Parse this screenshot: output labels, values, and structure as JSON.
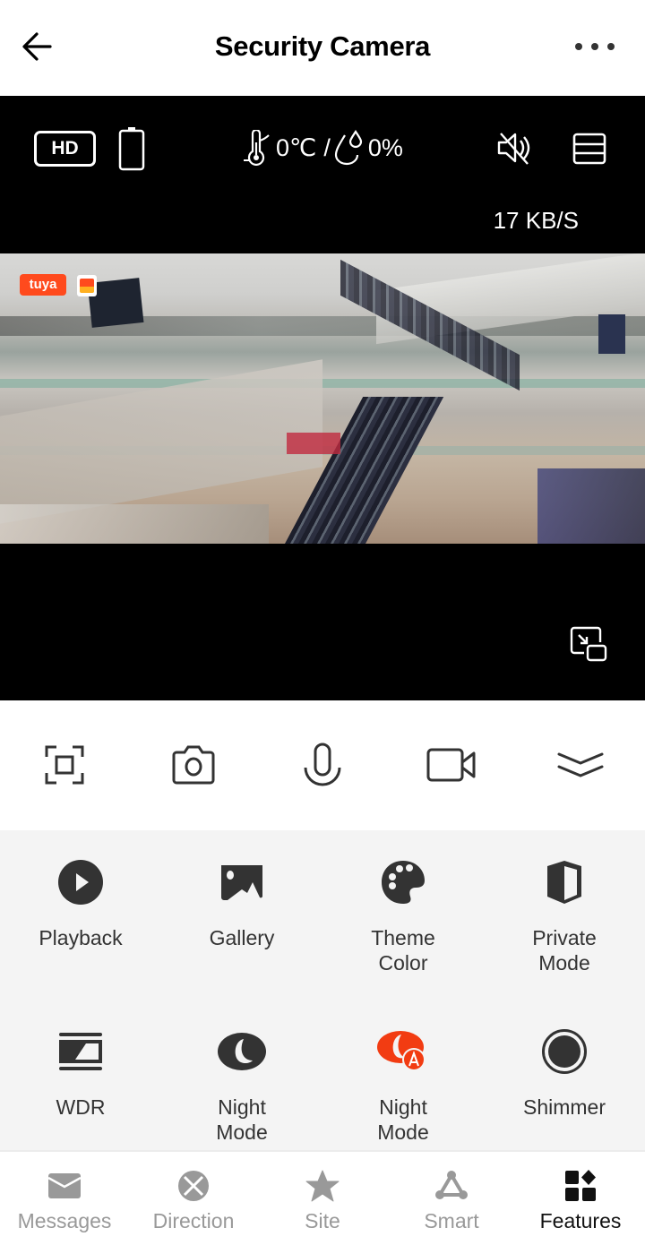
{
  "header": {
    "title": "Security Camera",
    "back_icon": "arrow-left-icon",
    "more_icon": "more-horizontal-icon"
  },
  "video": {
    "quality_badge": "HD",
    "battery_icon": "battery-icon",
    "temperature": "0℃",
    "separator": "/",
    "humidity": "0%",
    "temperature_icon": "thermometer-icon",
    "humidity_icon": "droplet-icon",
    "mute_icon": "speaker-muted-icon",
    "layout_icon": "layout-icon",
    "bitrate": "17 KB/S",
    "watermark": "tuya",
    "pip_icon": "picture-in-picture-icon"
  },
  "toolbar": {
    "items": [
      {
        "name": "fullscreen-button",
        "icon": "screen-frame-icon"
      },
      {
        "name": "screenshot-button",
        "icon": "camera-icon"
      },
      {
        "name": "talk-button",
        "icon": "microphone-icon"
      },
      {
        "name": "record-button",
        "icon": "video-camera-icon"
      },
      {
        "name": "collapse-button",
        "icon": "double-chevron-down-icon"
      }
    ]
  },
  "features": {
    "items": [
      {
        "label": "Playback",
        "icon": "play-circle-icon"
      },
      {
        "label": "Gallery",
        "icon": "image-icon"
      },
      {
        "label": "Theme\nColor",
        "icon": "palette-icon"
      },
      {
        "label": "Private\nMode",
        "icon": "shield-half-icon"
      },
      {
        "label": "WDR",
        "icon": "wdr-icon"
      },
      {
        "label": "Night\nMode",
        "icon": "moon-icon"
      },
      {
        "label": "Night\nMode",
        "icon": "moon-auto-icon",
        "active": true,
        "color": "#f23c12"
      },
      {
        "label": "Shimmer",
        "icon": "record-circle-icon"
      }
    ]
  },
  "bottom_nav": {
    "items": [
      {
        "label": "Messages",
        "icon": "envelope-icon"
      },
      {
        "label": "Direction",
        "icon": "direction-pad-icon"
      },
      {
        "label": "Site",
        "icon": "star-icon"
      },
      {
        "label": "Smart",
        "icon": "smart-triangle-icon"
      },
      {
        "label": "Features",
        "icon": "grid-icon",
        "active": true
      }
    ]
  },
  "colors": {
    "accent": "#f23c12",
    "icon_dark": "#333333",
    "nav_inactive": "#999999",
    "features_bg": "#f4f4f4"
  }
}
